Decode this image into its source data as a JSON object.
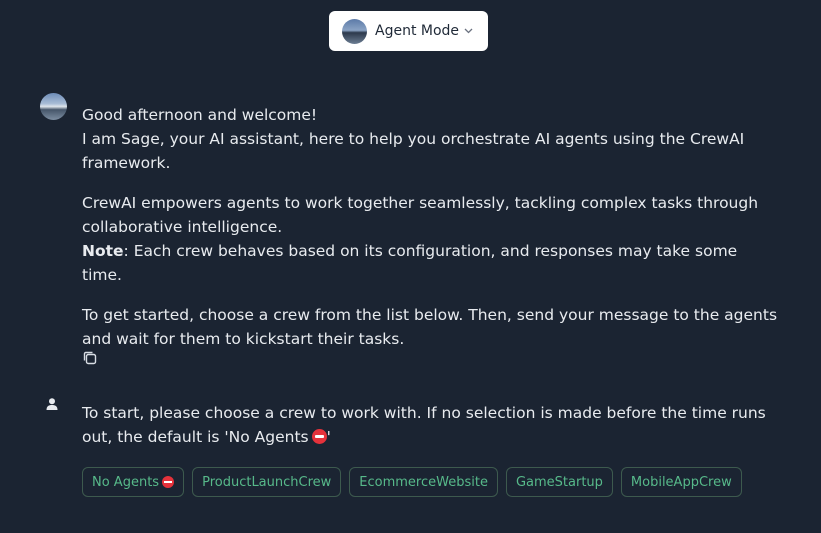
{
  "header": {
    "mode_label": "Agent Mode",
    "mode_avatar_icon": "agent-avatar",
    "chevron_icon": "chevron-down-icon"
  },
  "messages": {
    "bot": {
      "avatar_icon": "sage-avatar",
      "line1": "Good afternoon and welcome!",
      "line2": "I am Sage, your AI assistant, here to help you orchestrate AI agents using the CrewAI framework.",
      "para2": "CrewAI empowers agents to work together seamlessly, tackling complex tasks through collaborative intelligence.",
      "note_label": "Note",
      "note_text": ": Each crew behaves based on its configuration, and responses may take some time.",
      "para3": "To get started, choose a crew from the list below. Then, send your message to the agents and wait for them to kickstart their tasks.",
      "copy_icon": "copy-icon"
    },
    "user": {
      "avatar_icon": "user-icon",
      "text": "To start, please choose a crew to work with. If no selection is made before the time runs out, the default is 'No Agents",
      "text_end": "'"
    }
  },
  "crews": [
    {
      "label": "No Agents",
      "icon": "no-entry-icon"
    },
    {
      "label": "ProductLaunchCrew"
    },
    {
      "label": "EcommerceWebsite"
    },
    {
      "label": "GameStartup"
    },
    {
      "label": "MobileAppCrew"
    }
  ],
  "colors": {
    "background": "#1b2432",
    "crew_text": "#57b98a",
    "crew_border": "#3d5a4e",
    "no_entry": "#e5323b"
  }
}
